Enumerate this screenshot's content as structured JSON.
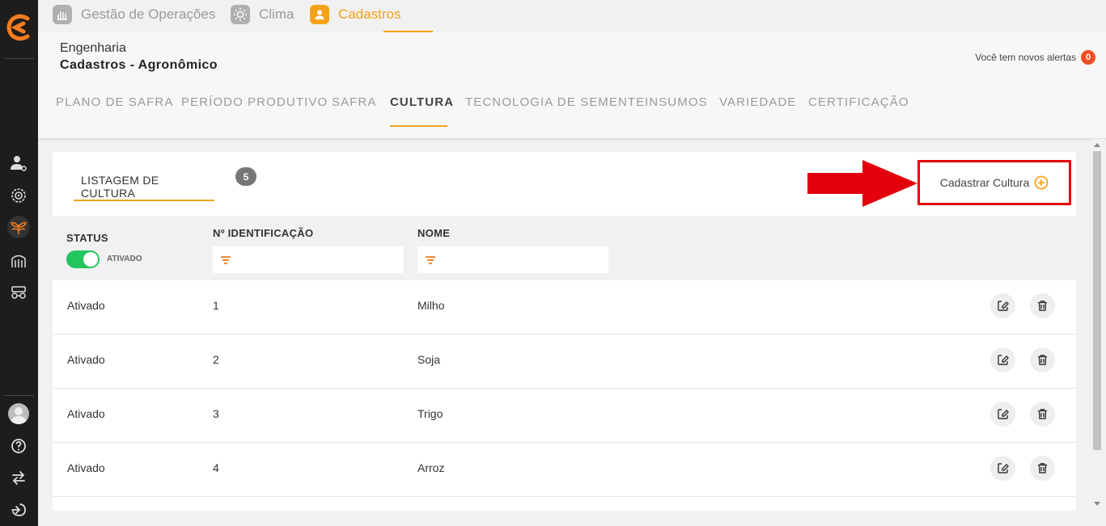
{
  "app_tabs": [
    {
      "label": "Gestão de Operações",
      "icon": "hand-icon"
    },
    {
      "label": "Clima",
      "icon": "sun-icon"
    },
    {
      "label": "Cadastros",
      "icon": "user-icon"
    }
  ],
  "header": {
    "breadcrumb_parent": "Engenharia",
    "breadcrumb_title": "Cadastros - Agronômico",
    "alerts_text": "Você tem novos alertas",
    "alerts_count": "0"
  },
  "subtabs": [
    "PLANO DE SAFRA",
    "PERÍODO PRODUTIVO",
    "SAFRA",
    "CULTURA",
    "TECNOLOGIA DE SEMENTE",
    "INSUMOS",
    "VARIEDADE",
    "CERTIFICAÇÃO"
  ],
  "active_subtab": "CULTURA",
  "listing": {
    "tab_label": "LISTAGEM DE CULTURA",
    "count": "5",
    "add_button": "Cadastrar Cultura"
  },
  "table": {
    "columns": {
      "status": "STATUS",
      "id": "Nº IDENTIFICAÇÃO",
      "name": "NOME"
    },
    "status_filter_label": "ATIVADO",
    "rows": [
      {
        "status": "Ativado",
        "id": "1",
        "name": "Milho"
      },
      {
        "status": "Ativado",
        "id": "2",
        "name": "Soja"
      },
      {
        "status": "Ativado",
        "id": "3",
        "name": "Trigo"
      },
      {
        "status": "Ativado",
        "id": "4",
        "name": "Arroz"
      }
    ]
  },
  "colors": {
    "accent": "#f5a21a",
    "sidebar": "#1d1d1d",
    "highlight": "#e3000b",
    "toggle_on": "#22c55e",
    "alert_badge": "#f04e23"
  }
}
